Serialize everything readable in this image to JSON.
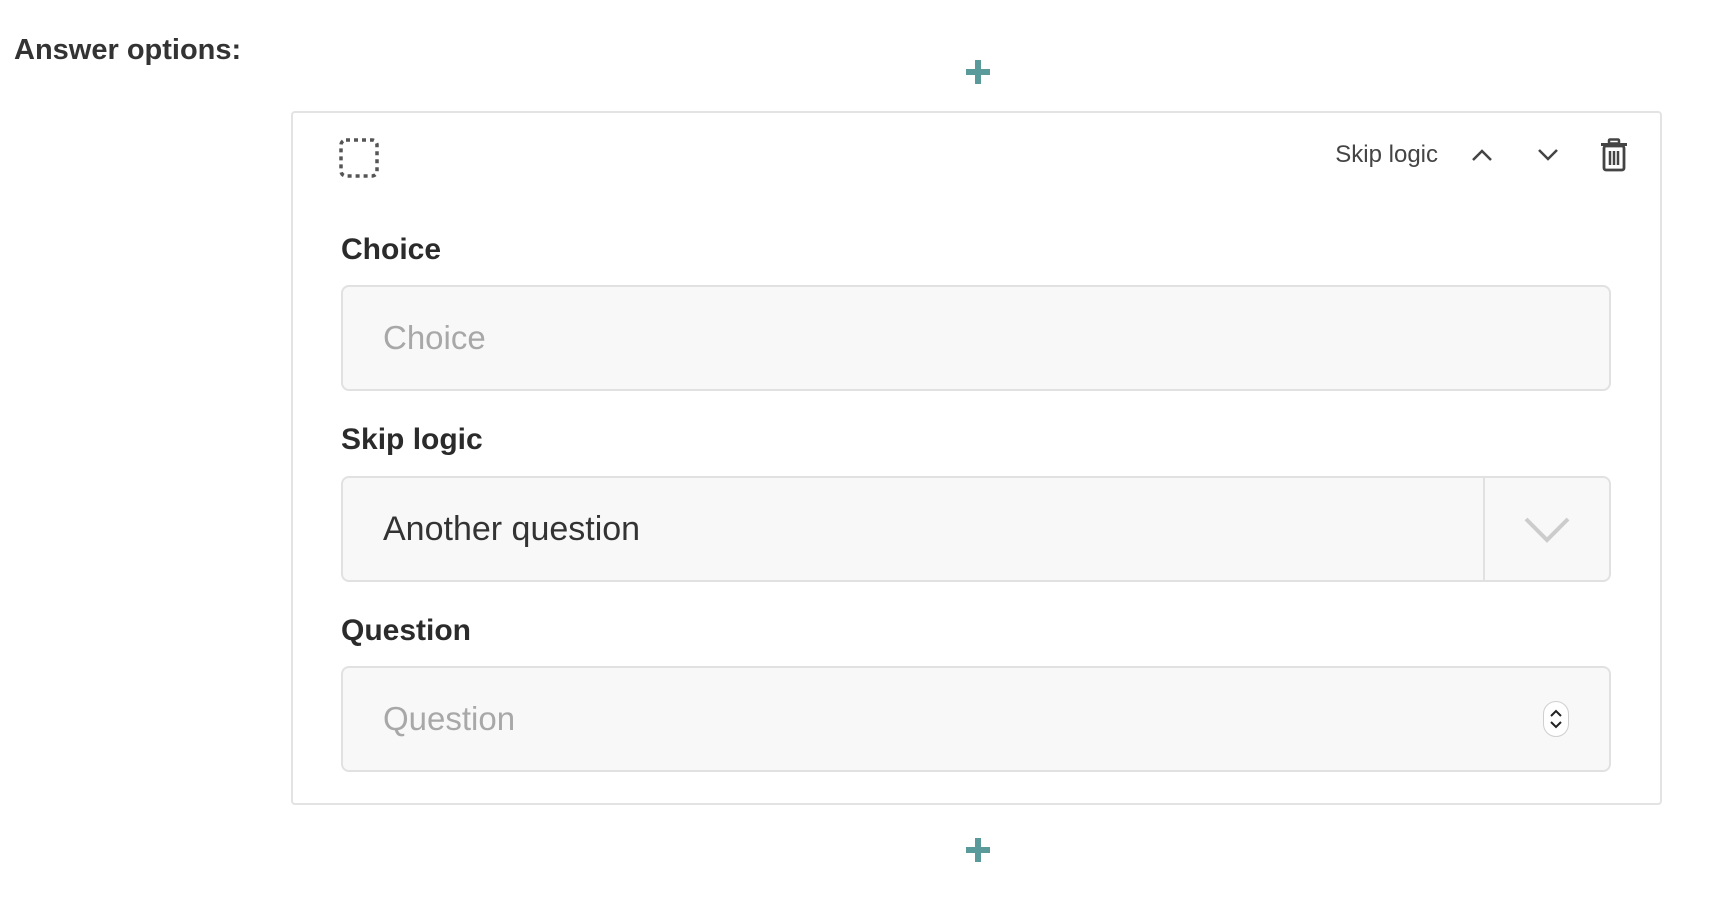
{
  "section": {
    "label": "Answer options:"
  },
  "add_top": {
    "icon": "plus-icon",
    "color": "#5a9a9a"
  },
  "add_bottom": {
    "icon": "plus-icon",
    "color": "#5a9a9a"
  },
  "card": {
    "drag_icon": "drag-handle-icon",
    "actions": {
      "skip_logic_label": "Skip logic",
      "move_up_icon": "chevron-up-icon",
      "move_down_icon": "chevron-down-icon",
      "delete_icon": "trash-icon"
    },
    "choice": {
      "label": "Choice",
      "placeholder": "Choice",
      "value": ""
    },
    "skip_logic": {
      "label": "Skip logic",
      "selected": "Another question"
    },
    "question": {
      "label": "Question",
      "placeholder": "Question",
      "value": ""
    }
  },
  "colors": {
    "accent": "#5a9a9a",
    "text": "#333333",
    "placeholder": "#a8a8a8",
    "field_bg": "#f8f8f8",
    "border": "#e1e1e1"
  }
}
